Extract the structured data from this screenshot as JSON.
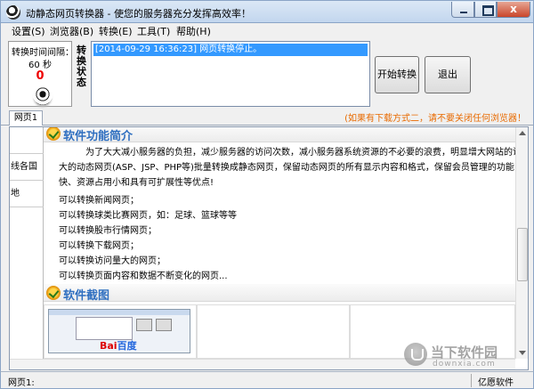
{
  "window": {
    "title": "动静态网页转换器 - 使您的服务器充分发挥高效率！",
    "close_glyph": "x"
  },
  "menu": [
    "设置(S)",
    "浏览器(B)",
    "转换(E)",
    "工具(T)",
    "帮助(H)"
  ],
  "interval": {
    "label": "转换时间间隔：",
    "value": "60 秒",
    "count": "0"
  },
  "status": {
    "label": "转换状态",
    "log": "[2014-09-29 16:36:23] 网页转换停止。"
  },
  "buttons": {
    "start": "开始转换",
    "exit": "退出"
  },
  "tab": {
    "label": "网页1",
    "notice": "(如果有下载方式二，请不要关闭任何浏览器！"
  },
  "left_items": [
    "",
    "线各国",
    "地"
  ],
  "intro": {
    "title": "软件功能简介",
    "paragraph": [
      "为了大大减小服务器的负担，减少服务器的访问次数，减小服务器系统资源的不必要的浪费，明显增大网站的访",
      "大的动态网页(ASP、JSP、PHP等)批量转换成静态网页，保留动态网页的所有显示内容和格式，保留会员管理的功能",
      "快、资源占用小和具有可扩展性等优点!"
    ],
    "lines": [
      "可以转换新闻网页；",
      "可以转换球类比赛网页，如：足球、篮球等等",
      "可以转换股市行情网页；",
      "可以转换下载网页；",
      "可以转换访问量大的网页；",
      "可以转换页面内容和数据不断变化的网页..."
    ]
  },
  "screens": {
    "title": "软件截图",
    "baidu_a": "Bai",
    "baidu_b": "百度"
  },
  "statusbar": {
    "left": "网页1:",
    "right": "亿愿软件"
  },
  "watermark": {
    "text": "当下软件园",
    "sub": "downxia.com"
  }
}
